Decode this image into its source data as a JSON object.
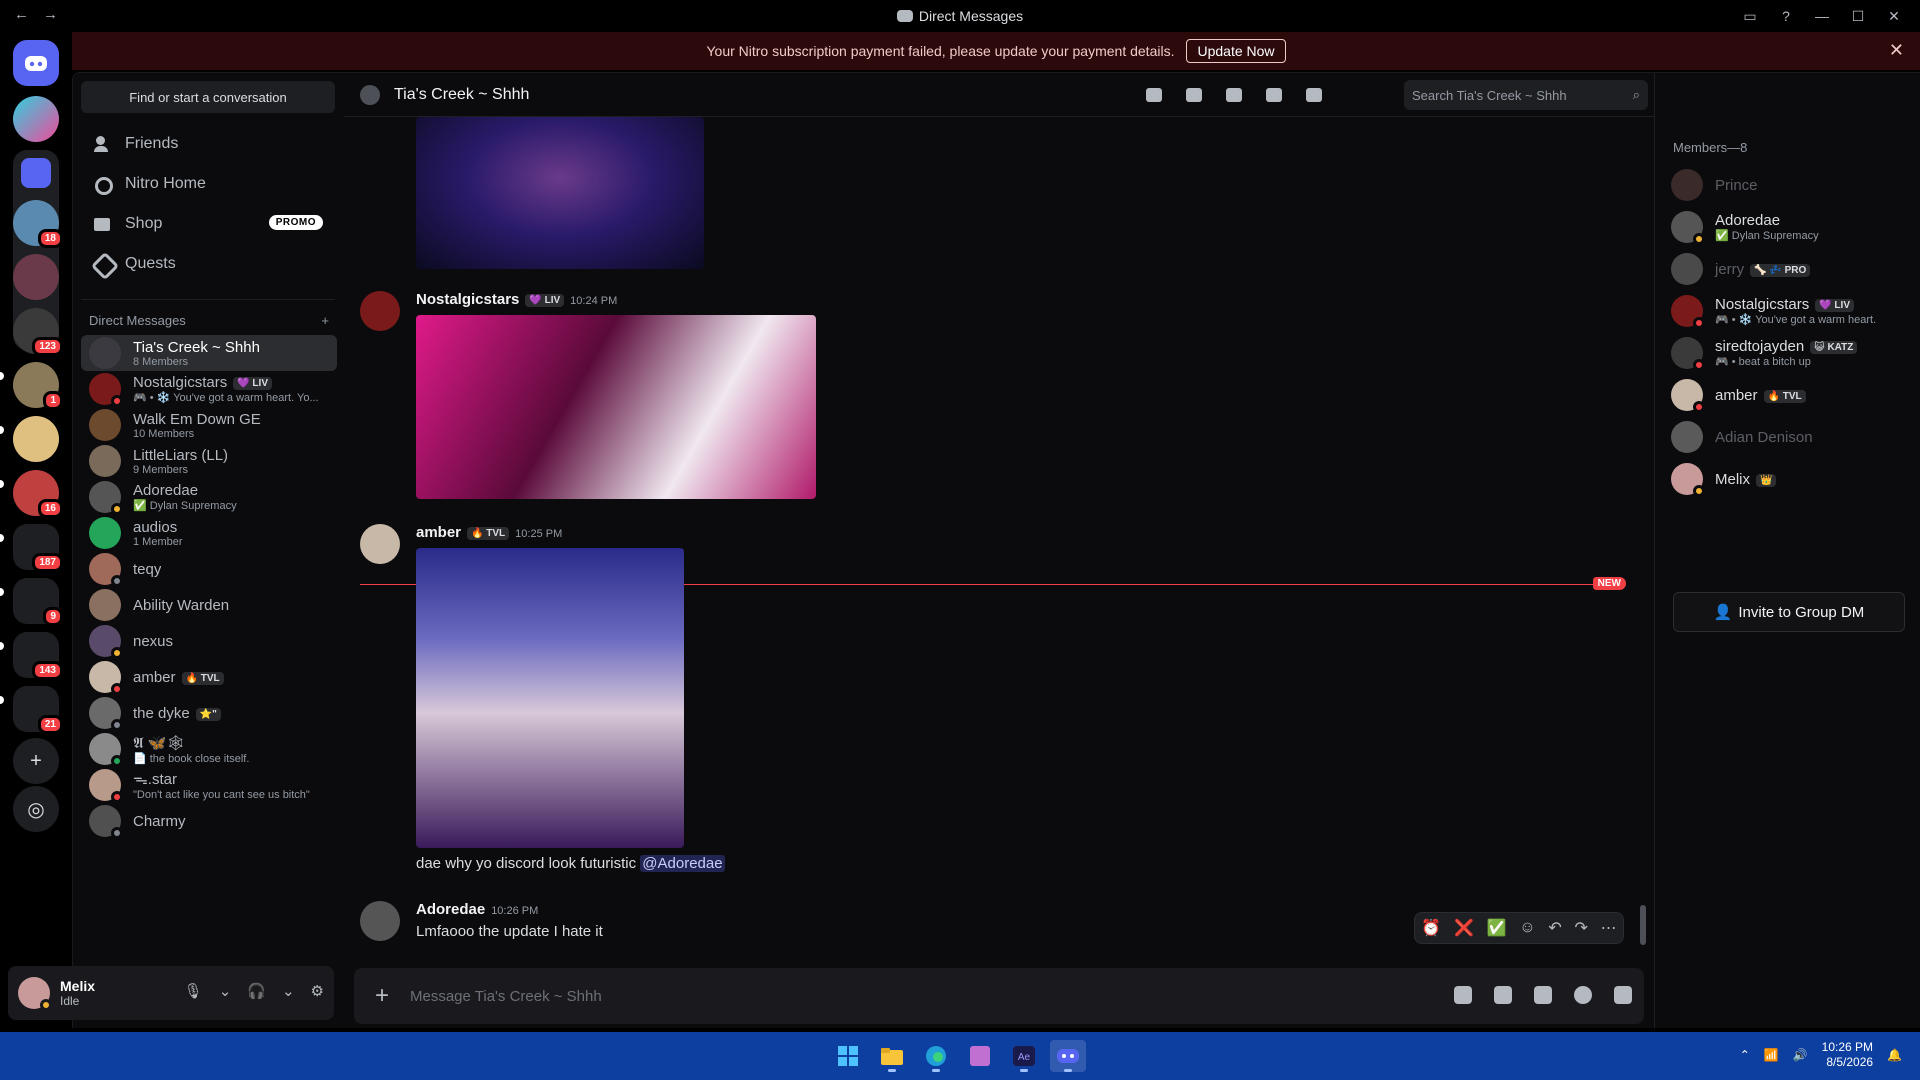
{
  "window": {
    "title": "Direct Messages",
    "back": "←",
    "forward": "→"
  },
  "banner": {
    "text": "Your Nitro subscription payment failed, please update your payment details.",
    "button": "Update Now",
    "close": "✕"
  },
  "rail": {
    "badges": [
      "18",
      "123",
      "1",
      "16",
      "187",
      "9",
      "143",
      "21"
    ],
    "add": "+",
    "explore": "◎"
  },
  "sidebar": {
    "search": "Find or start a conversation",
    "nav": [
      {
        "label": "Friends"
      },
      {
        "label": "Nitro Home"
      },
      {
        "label": "Shop",
        "badge": "PROMO"
      },
      {
        "label": "Quests"
      }
    ],
    "dm_header": "Direct Messages",
    "dm_add": "+",
    "dms": [
      {
        "name": "Tia's Creek ~ Shhh",
        "sub": "8 Members",
        "color": "#3a3a40",
        "active": true
      },
      {
        "name": "Nostalgicstars",
        "tag": "💜 LIV",
        "sub": "🎮 • ❄️ You've got a warm heart. Yo...",
        "color": "#7a1a1a",
        "status": "dnd"
      },
      {
        "name": "Walk Em Down GE",
        "sub": "10 Members",
        "color": "#6b4a2e"
      },
      {
        "name": "LittleLiars (LL)",
        "sub": "9 Members",
        "color": "#7a6a5a"
      },
      {
        "name": "Adoredae",
        "sub": "✅ Dylan Supremacy",
        "color": "#555",
        "status": "idle"
      },
      {
        "name": "audios",
        "sub": "1 Member",
        "color": "#23a55a"
      },
      {
        "name": "teqy",
        "sub": "",
        "color": "#a06a5a",
        "status": "off"
      },
      {
        "name": "Ability Warden",
        "sub": "",
        "color": "#8a7060"
      },
      {
        "name": "nexus",
        "sub": "",
        "color": "#5a4a6a",
        "status": "idle"
      },
      {
        "name": "amber",
        "tag": "🔥 TVL",
        "sub": "",
        "color": "#c8b8a8",
        "status": "dnd"
      },
      {
        "name": "the dyke",
        "tag": "⭐\"",
        "sub": "",
        "color": "#6a6a6a",
        "status": "off"
      },
      {
        "name": "𝕬 🦋🕸",
        "sub": "📄 the book close itself.",
        "color": "#8a8a8a",
        "status": "on"
      },
      {
        "name": "ᯓ.star",
        "sub": "\"Don't act like you cant see us bitch\"",
        "color": "#b89a8a",
        "status": "dnd"
      },
      {
        "name": "Charmy",
        "sub": "",
        "color": "#505050",
        "status": "off"
      }
    ]
  },
  "user": {
    "name": "Melix",
    "status": "Idle"
  },
  "chat": {
    "title": "Tia's Creek ~ Shhh",
    "search_placeholder": "Search Tia's Creek ~ Shhh",
    "messages": [
      {
        "author": "Nostalgicstars",
        "tag": "💜 LIV",
        "time": "10:24 PM"
      },
      {
        "author": "amber",
        "tag": "🔥 TVL",
        "time": "10:25 PM",
        "text": "dae why yo discord look futuristic",
        "mention": "@Adoredae"
      },
      {
        "author": "Adoredae",
        "time": "10:26 PM",
        "text": "Lmfaooo the update I hate it"
      }
    ],
    "new_label": "NEW",
    "reactions": [
      "⏰",
      "❌",
      "✅"
    ],
    "composer_placeholder": "Message Tia's Creek ~ Shhh"
  },
  "members": {
    "header": "Members—8",
    "list": [
      {
        "name": "Prince",
        "sub": "",
        "color": "#3a2a2a",
        "dim": true
      },
      {
        "name": "Adoredae",
        "sub": "✅ Dylan Supremacy",
        "color": "#555",
        "status": "idle"
      },
      {
        "name": "jerry",
        "tag": "🦴 💤 PRO",
        "sub": "",
        "color": "#4a4a4a",
        "dim": true
      },
      {
        "name": "Nostalgicstars",
        "tag": "💜 LIV",
        "sub": "🎮 • ❄️ You've got a warm heart.",
        "color": "#7a1a1a",
        "status": "dnd"
      },
      {
        "name": "siredtojayden",
        "tag": "😺 KATZ",
        "sub": "🎮 • beat a bitch up",
        "color": "#3a3a3a",
        "status": "dnd"
      },
      {
        "name": "amber",
        "tag": "🔥 TVL",
        "sub": "",
        "color": "#c8b8a8",
        "status": "dnd"
      },
      {
        "name": "Adian Denison",
        "sub": "",
        "color": "#5a5a5a",
        "dim": true
      },
      {
        "name": "Melix",
        "tag": "👑",
        "sub": "",
        "color": "#c89a9a",
        "status": "idle"
      }
    ],
    "invite": "Invite to Group DM"
  },
  "taskbar": {
    "time": "10:26 PM",
    "date": "8/5/2026"
  },
  "colors": {
    "accent": "#5865f2",
    "danger": "#f23f43",
    "online": "#23a55a",
    "idle": "#f0b232"
  }
}
